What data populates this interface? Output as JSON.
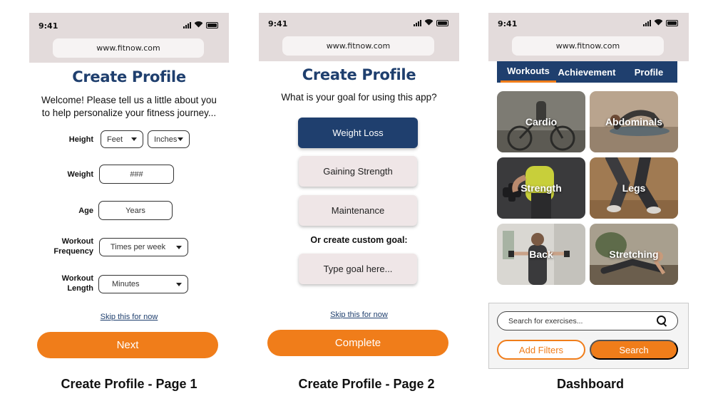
{
  "status_bar": {
    "time": "9:41"
  },
  "browser": {
    "url": "www.fitnow.com"
  },
  "page1": {
    "title": "Create Profile",
    "intro_line1": "Welcome! Please tell us a little about you",
    "intro_line2": "to help personalize your fitness journey...",
    "height_label": "Height",
    "feet_value": "Feet",
    "inches_value": "Inches",
    "weight_label": "Weight",
    "weight_placeholder": "###",
    "age_label": "Age",
    "age_placeholder": "Years",
    "frequency_label_line1": "Workout",
    "frequency_label_line2": "Frequency",
    "frequency_value": "Times per week",
    "length_label_line1": "Workout",
    "length_label_line2": "Length",
    "length_value": "Minutes",
    "skip_link": "Skip this for now",
    "next_button": "Next"
  },
  "page2": {
    "title": "Create Profile",
    "question": "What is your goal for using this app?",
    "goals": [
      "Weight Loss",
      "Gaining Strength",
      "Maintenance"
    ],
    "selected_goal": "Weight Loss",
    "custom_goal_label": "Or create custom goal:",
    "custom_goal_placeholder": "Type goal here...",
    "skip_link": "Skip this for now",
    "complete_button": "Complete"
  },
  "dashboard": {
    "tabs": [
      "Workouts",
      "Achievement",
      "Profile"
    ],
    "active_tab": "Workouts",
    "categories": [
      "Cardio",
      "Abdominals",
      "Strength",
      "Legs",
      "Back",
      "Stretching"
    ],
    "search_placeholder": "Search for exercises...",
    "add_filters_button": "Add Filters",
    "search_button": "Search"
  },
  "captions": [
    "Create Profile - Page 1",
    "Create Profile - Page 2",
    "Dashboard"
  ],
  "colors": {
    "navy": "#1f3f6e",
    "orange": "#f07d1a",
    "bar_gray": "#e3dbdb",
    "goal_pink": "#efe6e7"
  },
  "icons": [
    "signal-icon",
    "wifi-icon",
    "battery-icon",
    "search-icon",
    "dropdown-caret-icon"
  ]
}
